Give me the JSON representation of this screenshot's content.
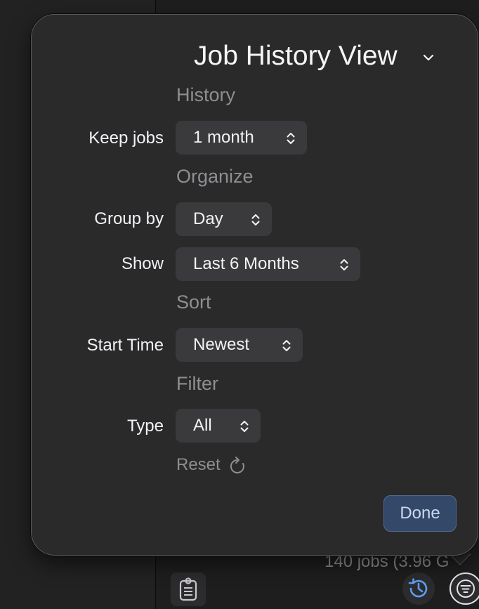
{
  "popover": {
    "title": "Job History View",
    "sections": {
      "history": "History",
      "organize": "Organize",
      "sort": "Sort",
      "filter": "Filter"
    },
    "rows": {
      "keep_jobs": {
        "label": "Keep jobs",
        "value": "1 month"
      },
      "group_by": {
        "label": "Group by",
        "value": "Day"
      },
      "show": {
        "label": "Show",
        "value": "Last 6 Months"
      },
      "start_time": {
        "label": "Start Time",
        "value": "Newest"
      },
      "type": {
        "label": "Type",
        "value": "All"
      }
    },
    "reset_label": "Reset",
    "done_label": "Done"
  },
  "background": {
    "status_text": "140 jobs (3.96 G"
  },
  "colors": {
    "popover_bg": "#2a2a2b",
    "popup_bg": "#3a3a3c",
    "section_text": "#8e8e93",
    "done_bg": "#34496a",
    "done_text": "#c9d7f0"
  },
  "icons": {
    "title_chevron": "chevron-down-icon",
    "popup_indicator": "up-down-chevron-icon",
    "reset": "reset-arrow-icon",
    "clipboard": "clipboard-icon",
    "history": "history-clock-icon",
    "filter": "filter-lines-icon"
  }
}
